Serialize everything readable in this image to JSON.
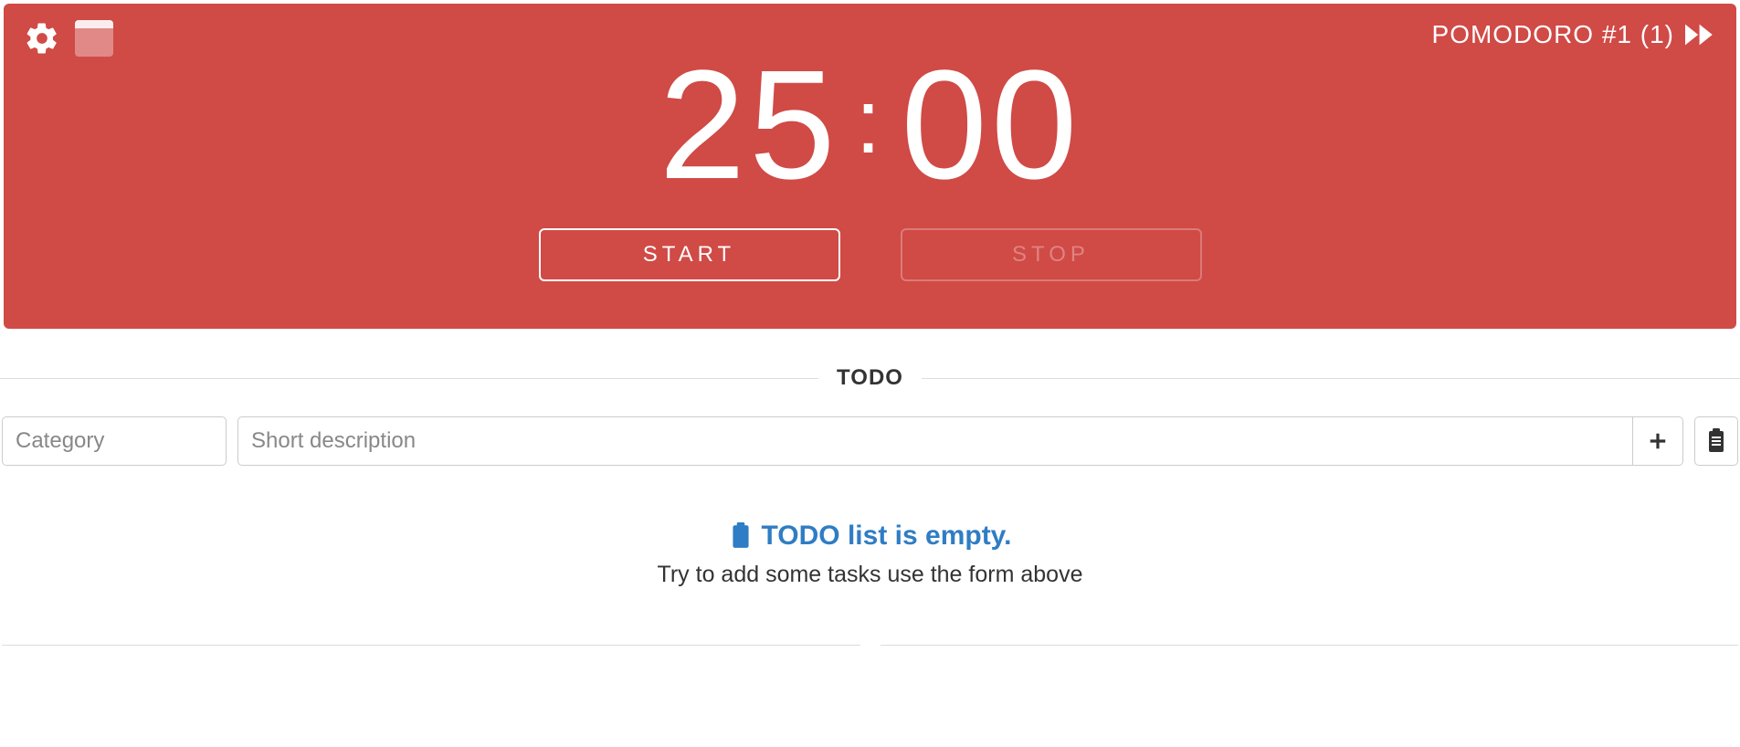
{
  "header": {
    "session_label": "POMODORO #1 (1)"
  },
  "timer": {
    "minutes": "25",
    "seconds": "00",
    "start_label": "START",
    "stop_label": "STOP"
  },
  "todo": {
    "section_title": "TODO",
    "category_placeholder": "Category",
    "description_placeholder": "Short description",
    "empty_title": "TODO list is empty.",
    "empty_subtitle": "Try to add some tasks use the form above"
  }
}
